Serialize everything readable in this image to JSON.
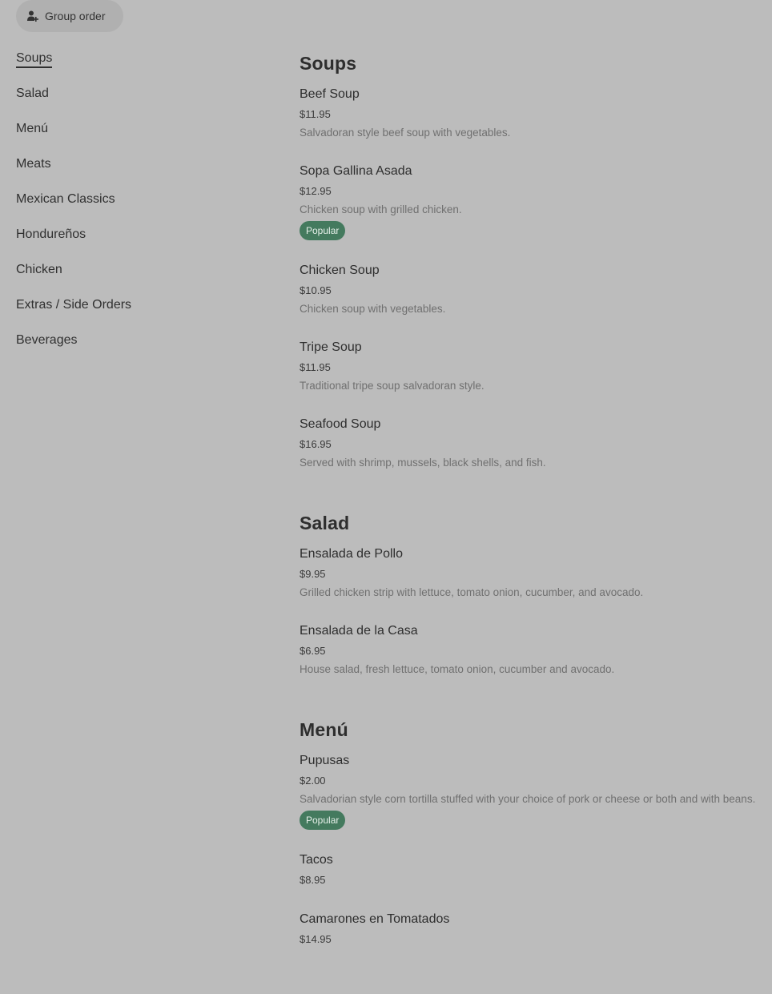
{
  "header": {
    "group_order_label": "Group order",
    "group_order_icon": "add-person-icon"
  },
  "sidebar": {
    "items": [
      {
        "label": "Soups",
        "active": true
      },
      {
        "label": "Salad"
      },
      {
        "label": "Menú"
      },
      {
        "label": "Meats"
      },
      {
        "label": "Mexican Classics"
      },
      {
        "label": "Hondureños"
      },
      {
        "label": "Chicken"
      },
      {
        "label": "Extras / Side Orders"
      },
      {
        "label": "Beverages"
      }
    ]
  },
  "sections": [
    {
      "title": "Soups",
      "items": [
        {
          "name": "Beef Soup",
          "price": "$11.95",
          "desc": "Salvadoran style beef soup with vegetables."
        },
        {
          "name": "Sopa Gallina Asada",
          "price": "$12.95",
          "desc": "Chicken soup with grilled chicken.",
          "badge": "Popular"
        },
        {
          "name": "Chicken Soup",
          "price": "$10.95",
          "desc": "Chicken soup with vegetables."
        },
        {
          "name": "Tripe Soup",
          "price": "$11.95",
          "desc": "Traditional tripe soup salvadoran style."
        },
        {
          "name": "Seafood Soup",
          "price": "$16.95",
          "desc": "Served with shrimp, mussels, black shells, and fish."
        }
      ]
    },
    {
      "title": "Salad",
      "items": [
        {
          "name": "Ensalada de Pollo",
          "price": "$9.95",
          "desc": "Grilled chicken strip with lettuce, tomato onion, cucumber, and avocado."
        },
        {
          "name": "Ensalada de la Casa",
          "price": "$6.95",
          "desc": "House salad, fresh lettuce, tomato onion, cucumber and avocado."
        }
      ]
    },
    {
      "title": "Menú",
      "items": [
        {
          "name": "Pupusas",
          "price": "$2.00",
          "desc": "Salvadorian style corn tortilla stuffed with your choice of pork or cheese or both and with beans.",
          "badge": "Popular"
        },
        {
          "name": "Tacos",
          "price": "$8.95"
        },
        {
          "name": "Camarones en Tomatados",
          "price": "$14.95"
        }
      ]
    }
  ],
  "colors": {
    "background": "#bcbcbc",
    "badge": "#447a5e"
  }
}
